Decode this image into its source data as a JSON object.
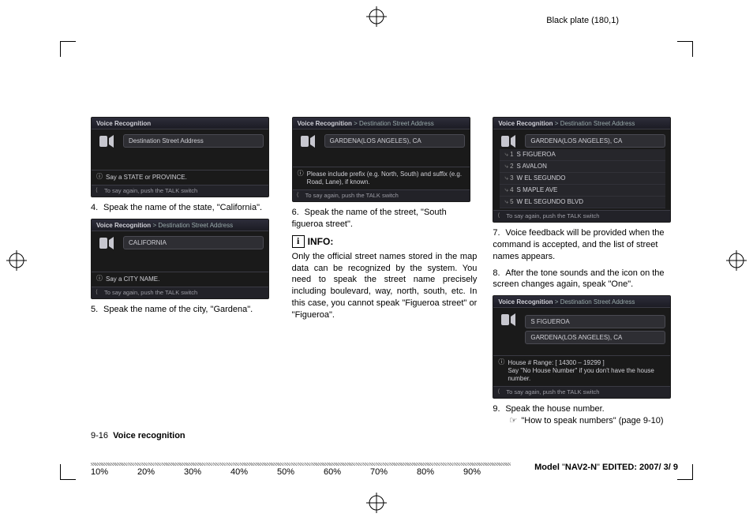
{
  "header": {
    "black_plate": "Black plate (180,1)"
  },
  "col1": {
    "screen1": {
      "title": "Voice Recognition",
      "pill": "Destination Street Address",
      "info": "Say a STATE or PROVINCE.",
      "footer": "To say again, push the TALK switch"
    },
    "step4": "Speak the name of the state, \"California\".",
    "screen2": {
      "title_prefix": "Voice Recognition",
      "title_crumb": "Destination Street Address",
      "pill": "CALIFORNIA",
      "info": "Say a CITY NAME.",
      "footer": "To say again, push the TALK switch"
    },
    "step5": "Speak the name of the city, \"Gardena\"."
  },
  "col2": {
    "screen1": {
      "title_prefix": "Voice Recognition",
      "title_crumb": "Destination Street Address",
      "pill": "GARDENA(LOS ANGELES), CA",
      "info": "Please include prefix (e.g. North, South) and suffix (e.g. Road, Lane), if known.",
      "footer": "To say again, push the TALK switch"
    },
    "step6": "Speak the name of the street, \"South figueroa street\".",
    "info_label": "INFO:",
    "info_para": "Only the official street names stored in the map data can be recognized by the system. You need to speak the street name precisely including boulevard, way, north, south, etc. In this case, you cannot speak \"Figueroa street\" or \"Figueroa\"."
  },
  "col3": {
    "screen1": {
      "title_prefix": "Voice Recognition",
      "title_crumb": "Destination Street Address",
      "pill": "GARDENA(LOS ANGELES), CA",
      "list": [
        {
          "n": "1",
          "t": "S FIGUEROA"
        },
        {
          "n": "2",
          "t": "S AVALON"
        },
        {
          "n": "3",
          "t": "W EL SEGUNDO"
        },
        {
          "n": "4",
          "t": "S MAPLE AVE"
        },
        {
          "n": "5",
          "t": "W EL SEGUNDO BLVD"
        }
      ],
      "footer": "To say again, push the TALK switch"
    },
    "step7": "Voice feedback will be provided when the command is accepted, and the list of street names appears.",
    "step8": "After the tone sounds and the icon on the screen changes again, speak \"One\".",
    "screen2": {
      "title_prefix": "Voice Recognition",
      "title_crumb": "Destination Street Address",
      "pill1": "S FIGUEROA",
      "pill2": "GARDENA(LOS ANGELES), CA",
      "info": "House # Range: [ 14300 – 19299 ]\nSay \"No House Number\" if you don't have the house number.",
      "footer": "To say again, push the TALK switch"
    },
    "step9": "Speak the house number.",
    "xref": "\"How to speak numbers\" (page 9-10)"
  },
  "footer": {
    "page": "9-16",
    "section": "Voice recognition",
    "model_label": "Model",
    "model_value": "NAV2-N",
    "edited": "EDITED: 2007/ 3/ 9",
    "percents": [
      "10%",
      "20%",
      "30%",
      "40%",
      "50%",
      "60%",
      "70%",
      "80%",
      "90%"
    ]
  }
}
